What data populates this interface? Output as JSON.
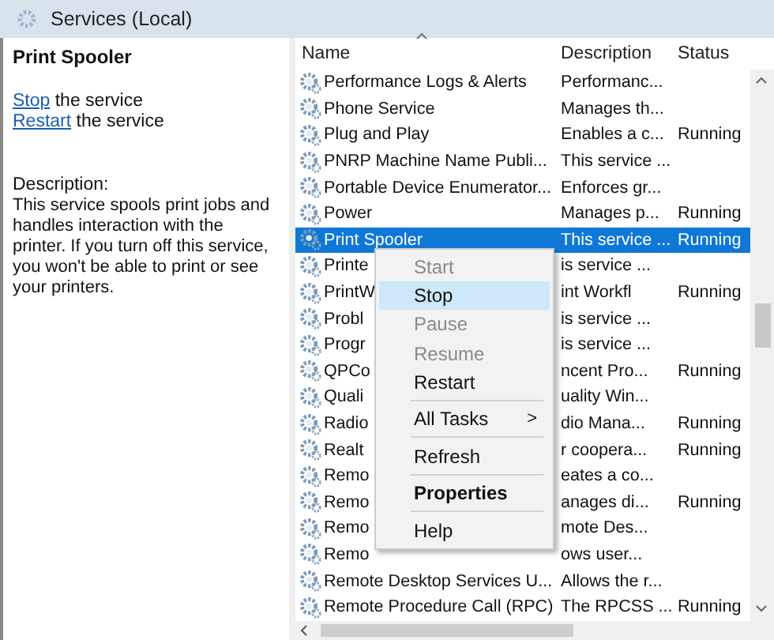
{
  "window": {
    "title": "Services (Local)"
  },
  "details": {
    "title": "Print Spooler",
    "actions": [
      {
        "link": "Stop",
        "text": " the service"
      },
      {
        "link": "Restart",
        "text": " the service"
      }
    ],
    "description_label": "Description:",
    "description": "This service spools print jobs and handles interaction with the printer. If you turn off this service, you won't be able to print or see your printers."
  },
  "table": {
    "columns": [
      "Name",
      "Description",
      "Status"
    ],
    "rows": [
      {
        "name": "Performance Logs & Alerts",
        "description": "Performanc...",
        "selected": false
      },
      {
        "name": "Phone Service",
        "description": "Manages th...",
        "selected": false
      },
      {
        "name": "Plug and Play",
        "description": "Enables a c...",
        "status": "Running",
        "selected": false
      },
      {
        "name": "PNRP Machine Name Publi...",
        "description": "This service ...",
        "selected": false
      },
      {
        "name": "Portable Device Enumerator...",
        "description": "Enforces gr...",
        "selected": false
      },
      {
        "name": "Power",
        "description": "Manages p...",
        "status": "Running",
        "selected": false
      },
      {
        "name": "Print Spooler",
        "description": "This service ...",
        "status": "Running",
        "selected": true
      },
      {
        "name": "Printe",
        "description": "is service ...",
        "selected": false
      },
      {
        "name": "PrintW",
        "description": "int Workfl",
        "status": "Running",
        "selected": false
      },
      {
        "name": "Probl",
        "description": "is service ...",
        "selected": false
      },
      {
        "name": "Progr",
        "description": "is service ...",
        "selected": false
      },
      {
        "name": "QPCo",
        "description": "ncent Pro...",
        "status": "Running",
        "selected": false
      },
      {
        "name": "Quali",
        "description": "uality Win...",
        "selected": false
      },
      {
        "name": "Radio",
        "description": "dio Mana...",
        "status": "Running",
        "selected": false
      },
      {
        "name": "Realt",
        "description": "r coopera...",
        "status": "Running",
        "selected": false
      },
      {
        "name": "Remo",
        "description": "eates a co...",
        "selected": false
      },
      {
        "name": "Remo",
        "description": "anages di...",
        "status": "Running",
        "selected": false
      },
      {
        "name": "Remo",
        "description": "mote Des...",
        "selected": false
      },
      {
        "name": "Remo",
        "description": "ows user...",
        "selected": false
      },
      {
        "name": "Remote Desktop Services U...",
        "description": "Allows the r...",
        "selected": false
      },
      {
        "name": "Remote Procedure Call (RPC)",
        "description": "The RPCSS ...",
        "status": "Running",
        "selected": false
      }
    ]
  },
  "context_menu": {
    "items": [
      {
        "label": "Start",
        "disabled": true,
        "selected": false,
        "default": false,
        "separator_before": false
      },
      {
        "label": "Stop",
        "disabled": false,
        "selected": true,
        "default": false,
        "separator_before": false
      },
      {
        "label": "Pause",
        "disabled": true,
        "selected": false,
        "default": false,
        "separator_before": false
      },
      {
        "label": "Resume",
        "disabled": true,
        "selected": false,
        "default": false,
        "separator_before": false
      },
      {
        "label": "Restart",
        "disabled": false,
        "selected": false,
        "default": false,
        "separator_before": false
      },
      {
        "label": "All Tasks",
        "submenu": ">",
        "disabled": false,
        "selected": false,
        "default": false,
        "separator_before": true
      },
      {
        "label": "Refresh",
        "disabled": false,
        "selected": false,
        "default": false,
        "separator_before": true
      },
      {
        "label": "Properties",
        "disabled": false,
        "selected": false,
        "default": true,
        "separator_before": true
      },
      {
        "label": "Help",
        "disabled": false,
        "selected": false,
        "default": false,
        "separator_before": true
      }
    ]
  }
}
